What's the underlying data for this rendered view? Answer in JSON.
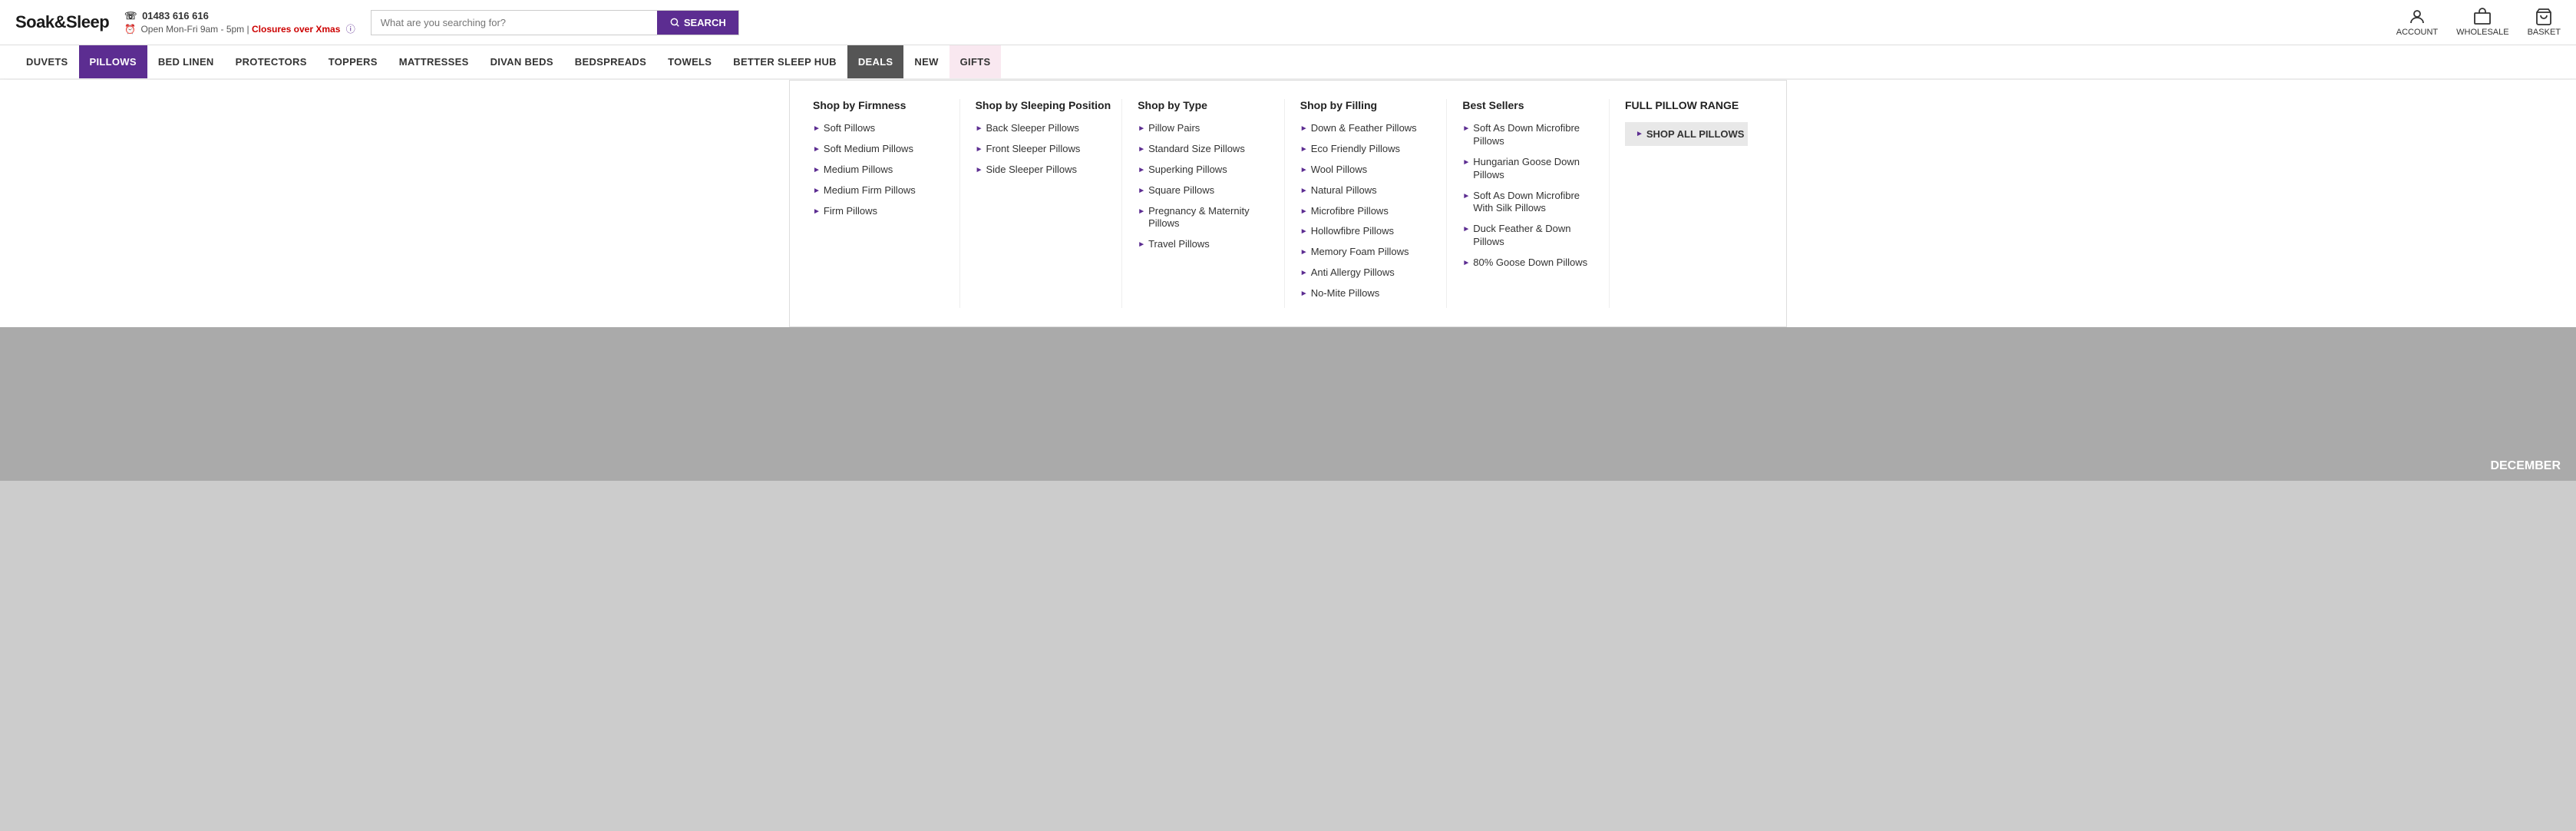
{
  "header": {
    "logo": "Soak&Sleep",
    "phone": "01483 616 616",
    "hours": "Open Mon-Fri 9am - 5pm |",
    "closures": "Closures over Xmas",
    "search_placeholder": "What are you searching for?",
    "search_button": "SEARCH",
    "icons": [
      {
        "name": "account-icon",
        "label": "ACCOUNT"
      },
      {
        "name": "wholesale-icon",
        "label": "WHOLESALE"
      },
      {
        "name": "basket-icon",
        "label": "BASKET"
      }
    ]
  },
  "nav": {
    "items": [
      {
        "label": "DUVETS",
        "active": false,
        "style": "normal"
      },
      {
        "label": "PILLOWS",
        "active": true,
        "style": "active"
      },
      {
        "label": "BED LINEN",
        "active": false,
        "style": "normal"
      },
      {
        "label": "PROTECTORS",
        "active": false,
        "style": "normal"
      },
      {
        "label": "TOPPERS",
        "active": false,
        "style": "normal"
      },
      {
        "label": "MATTRESSES",
        "active": false,
        "style": "normal"
      },
      {
        "label": "DIVAN BEDS",
        "active": false,
        "style": "normal"
      },
      {
        "label": "BEDSPREADS",
        "active": false,
        "style": "normal"
      },
      {
        "label": "TOWELS",
        "active": false,
        "style": "normal"
      },
      {
        "label": "BETTER SLEEP HUB",
        "active": false,
        "style": "normal"
      },
      {
        "label": "DEALS",
        "active": false,
        "style": "deals"
      },
      {
        "label": "NEW",
        "active": false,
        "style": "new"
      },
      {
        "label": "GIFTS",
        "active": false,
        "style": "gifts"
      }
    ]
  },
  "dropdown": {
    "cols": [
      {
        "title": "Shop by Firmness",
        "items": [
          "Soft Pillows",
          "Soft Medium Pillows",
          "Medium Pillows",
          "Medium Firm Pillows",
          "Firm Pillows"
        ]
      },
      {
        "title": "Shop by Sleeping Position",
        "items": [
          "Back Sleeper Pillows",
          "Front Sleeper Pillows",
          "Side Sleeper Pillows"
        ]
      },
      {
        "title": "Shop by Type",
        "items": [
          "Pillow Pairs",
          "Standard Size Pillows",
          "Superking Pillows",
          "Square Pillows",
          "Pregnancy & Maternity Pillows",
          "Travel Pillows"
        ]
      },
      {
        "title": "Shop by Filling",
        "items": [
          "Down & Feather Pillows",
          "Eco Friendly Pillows",
          "Wool Pillows",
          "Natural Pillows",
          "Microfibre Pillows",
          "Hollowfibre Pillows",
          "Memory Foam Pillows",
          "Anti Allergy Pillows",
          "No-Mite Pillows"
        ]
      },
      {
        "title": "Best Sellers",
        "items": [
          "Soft As Down Microfibre Pillows",
          "Hungarian Goose Down Pillows",
          "Soft As Down Microfibre With Silk Pillows",
          "Duck Feather & Down Pillows",
          "80% Goose Down Pillows"
        ]
      }
    ],
    "full_range": {
      "title": "FULL PILLOW RANGE",
      "cta": "SHOP ALL PILLOWS"
    }
  },
  "footer_label": "DECEMBER"
}
